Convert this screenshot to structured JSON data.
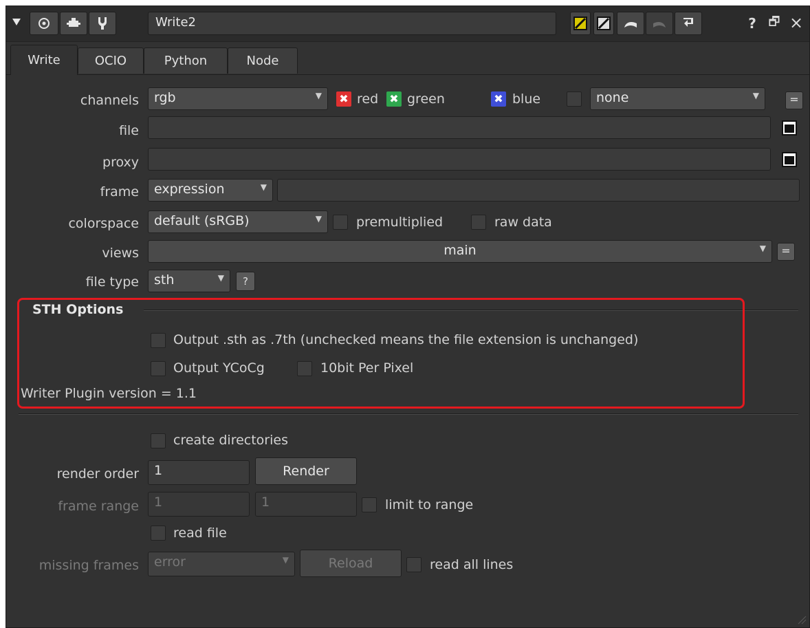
{
  "node_name": "Write2",
  "tabs": [
    "Write",
    "OCIO",
    "Python",
    "Node"
  ],
  "active_tab": "Write",
  "channels": {
    "label": "channels",
    "value": "rgb",
    "red": "red",
    "green": "green",
    "blue": "blue",
    "extra_value": "none",
    "colors": {
      "red": "#e03131",
      "green": "#2fa84f",
      "blue": "#3f4fd8"
    }
  },
  "file": {
    "label": "file",
    "value": ""
  },
  "proxy": {
    "label": "proxy",
    "value": ""
  },
  "frame": {
    "label": "frame",
    "value": "expression",
    "expr": ""
  },
  "colorspace": {
    "label": "colorspace",
    "value": "default (sRGB)",
    "premultiplied": "premultiplied",
    "raw_data": "raw data"
  },
  "views": {
    "label": "views",
    "value": "main"
  },
  "file_type": {
    "label": "file type",
    "value": "sth",
    "help": "?"
  },
  "sth": {
    "title": "STH Options",
    "output_7th": "Output .sth as .7th (unchecked means the file extension is unchanged)",
    "output_ycocg": "Output YCoCg",
    "tenbit": "10bit Per Pixel",
    "version": "Writer Plugin version = 1.1"
  },
  "create_directories": "create directories",
  "render_order": {
    "label": "render order",
    "value": "1",
    "button": "Render"
  },
  "frame_range": {
    "label": "frame range",
    "first": "1",
    "last": "1",
    "limit": "limit to range"
  },
  "read_file": "read file",
  "missing_frames": {
    "label": "missing frames",
    "value": "error",
    "reload": "Reload",
    "read_all_lines": "read all lines"
  },
  "title_buttons": {
    "help": "?",
    "float": "🗗",
    "close": "×"
  },
  "icons": [
    "collapse-arrow-icon",
    "center-node-icon",
    "node-color-icon",
    "fork-icon",
    "color-yellow-swatch-icon",
    "color-white-swatch-icon",
    "undo-icon",
    "redo-icon",
    "revert-icon",
    "help-icon",
    "float-window-icon",
    "close-icon"
  ]
}
